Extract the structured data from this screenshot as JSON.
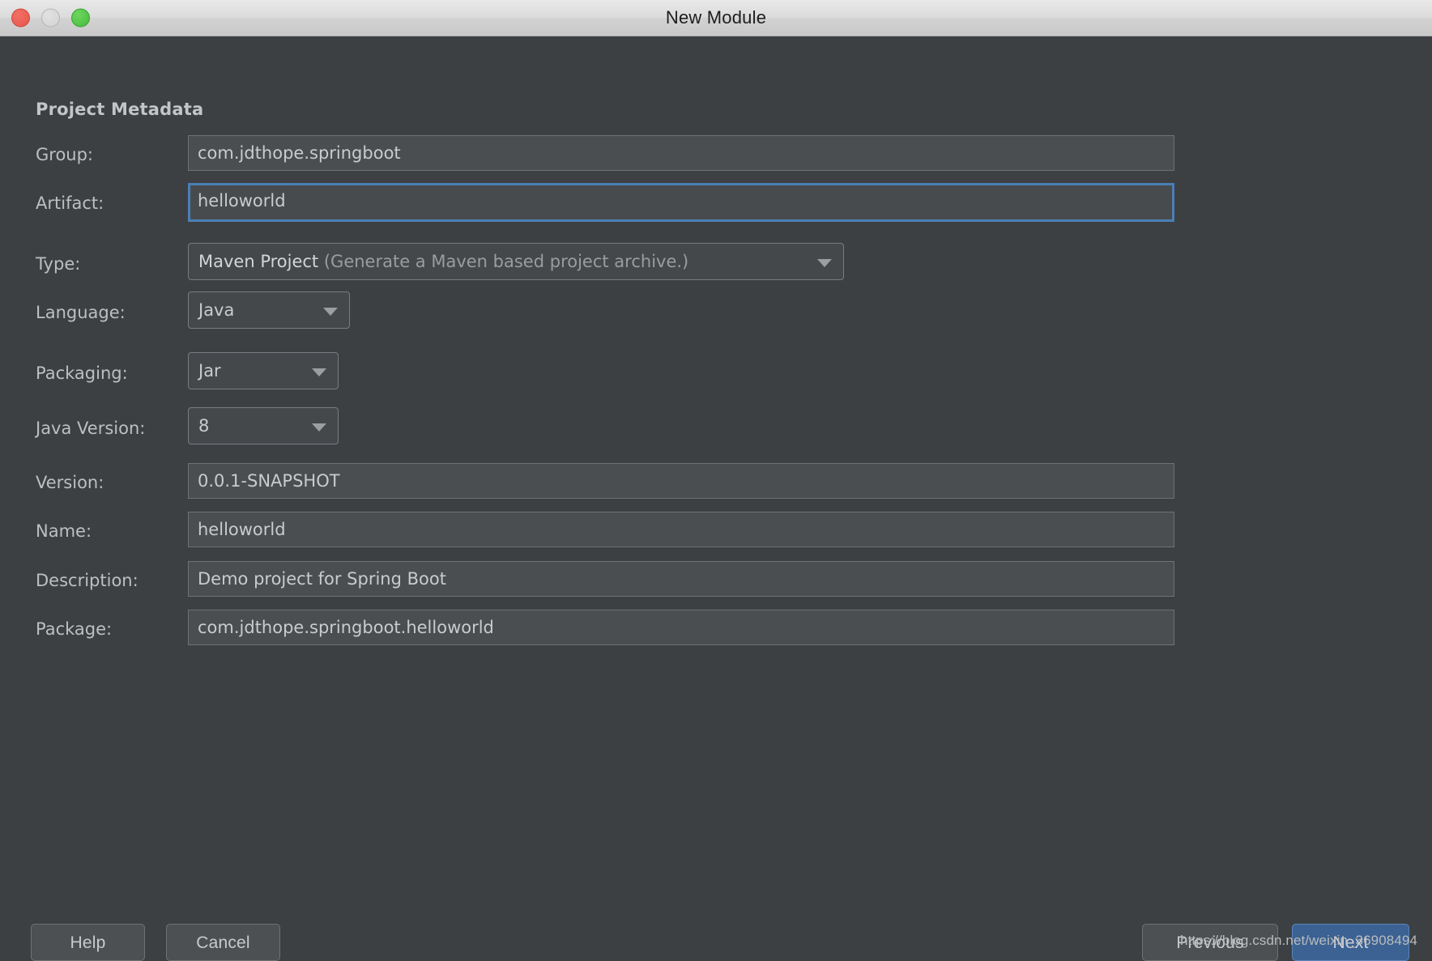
{
  "window": {
    "title": "New Module",
    "controls": [
      {
        "name": "close-button",
        "color": "#e5554a"
      },
      {
        "name": "minimize-button",
        "color": "#d2d2d2"
      },
      {
        "name": "zoom-button",
        "color": "#45bd3b"
      }
    ]
  },
  "section": {
    "title": "Project Metadata"
  },
  "fields": {
    "group": {
      "label": "Group:",
      "value": "com.jdthope.springboot"
    },
    "artifact": {
      "label": "Artifact:",
      "value": "helloworld",
      "focused": true
    },
    "type": {
      "label": "Type:",
      "value_primary": "Maven Project",
      "value_secondary": "(Generate a Maven based project archive.)"
    },
    "language": {
      "label": "Language:",
      "value": "Java"
    },
    "packaging": {
      "label": "Packaging:",
      "value": "Jar"
    },
    "java_version": {
      "label": "Java Version:",
      "value": "8"
    },
    "version": {
      "label": "Version:",
      "value": "0.0.1-SNAPSHOT"
    },
    "name": {
      "label": "Name:",
      "value": "helloworld"
    },
    "description": {
      "label": "Description:",
      "value": "Demo project for Spring Boot"
    },
    "package": {
      "label": "Package:",
      "value": "com.jdthope.springboot.helloworld"
    }
  },
  "footer": {
    "help": "Help",
    "cancel": "Cancel",
    "previous": "Previous",
    "next": "Next"
  },
  "watermark": "https://blog.csdn.net/weixin_36908494",
  "colors": {
    "dialog_bg": "#3c4043",
    "field_bg": "#4a4e51",
    "focus_border": "#4a7fb5",
    "primary_button": "#3c6293",
    "text": "#c9cbcd"
  }
}
